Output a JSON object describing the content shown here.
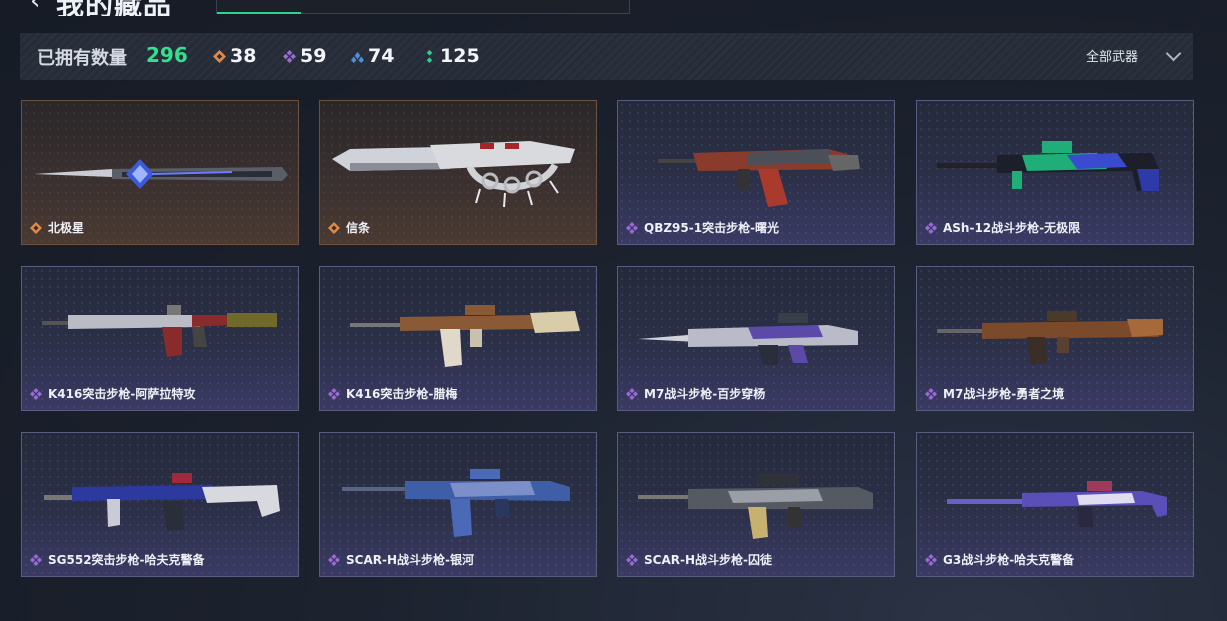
{
  "header": {
    "title": "我的藏品",
    "back_icon": "chevron-left-icon"
  },
  "stats": {
    "owned_label": "已拥有数量",
    "owned_count": "296",
    "items": [
      {
        "icon": "orange-diamond-icon",
        "color": "#e08a45",
        "value": "38"
      },
      {
        "icon": "purple-diamond-icon",
        "color": "#9b6ad8",
        "value": "59"
      },
      {
        "icon": "blue-diamond-icon",
        "color": "#4a8fd8",
        "value": "74"
      },
      {
        "icon": "green-diamond-icon",
        "color": "#2fcf8a",
        "value": "125"
      }
    ]
  },
  "filter": {
    "label": "全部武器",
    "icon": "chevron-down-icon"
  },
  "colors": {
    "accent": "#32e08f",
    "orange": "#e08a45",
    "purple": "#9b6ad8"
  },
  "items": [
    {
      "name": "北极星",
      "rarity": "orange"
    },
    {
      "name": "信条",
      "rarity": "orange"
    },
    {
      "name": "QBZ95-1突击步枪-曙光",
      "rarity": "purple"
    },
    {
      "name": "ASh-12战斗步枪-无极限",
      "rarity": "purple"
    },
    {
      "name": "K416突击步枪-阿萨拉特攻",
      "rarity": "purple"
    },
    {
      "name": "K416突击步枪-腊梅",
      "rarity": "purple"
    },
    {
      "name": "M7战斗步枪-百步穿杨",
      "rarity": "purple"
    },
    {
      "name": "M7战斗步枪-勇者之境",
      "rarity": "purple"
    },
    {
      "name": "SG552突击步枪-哈夫克警备",
      "rarity": "purple"
    },
    {
      "name": "SCAR-H战斗步枪-银河",
      "rarity": "purple"
    },
    {
      "name": "SCAR-H战斗步枪-囚徒",
      "rarity": "purple"
    },
    {
      "name": "G3战斗步枪-哈夫克警备",
      "rarity": "purple"
    }
  ]
}
